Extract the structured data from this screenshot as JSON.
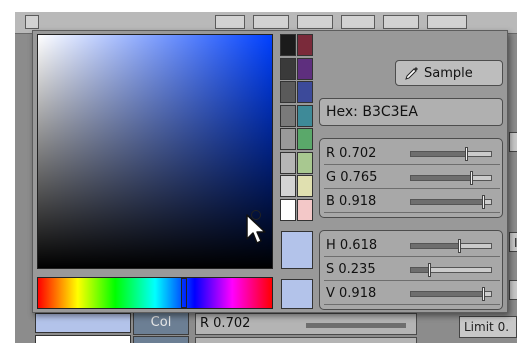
{
  "popup": {
    "sample_button": "Sample",
    "hex_label": "Hex: B3C3EA",
    "rgb": [
      {
        "label": "R 0.702",
        "value": 0.702
      },
      {
        "label": "G 0.765",
        "value": 0.765
      },
      {
        "label": "B 0.918",
        "value": 0.918
      }
    ],
    "hsv": [
      {
        "label": "H 0.618",
        "value": 0.618
      },
      {
        "label": "S 0.235",
        "value": 0.235
      },
      {
        "label": "V 0.918",
        "value": 0.918
      }
    ],
    "current_color": "#b3c3ea",
    "palette": [
      [
        "#1b1b1b",
        "#7a2a3a"
      ],
      [
        "#3a3a3a",
        "#5e2f7e"
      ],
      [
        "#5a5a5a",
        "#3c4a9a"
      ],
      [
        "#7a7a7a",
        "#3e8a98"
      ],
      [
        "#9a9a9a",
        "#5aa86a"
      ],
      [
        "#b6b6b6",
        "#a8c890"
      ],
      [
        "#d4d4d4",
        "#e0e0b0"
      ],
      [
        "#ffffff",
        "#f3c8c8"
      ]
    ],
    "pointer_icon": "mouse-pointer-icon",
    "eyedropper_icon": "eyedropper-icon"
  },
  "background": {
    "col_tab": "Col",
    "r_field": "R 0.702",
    "limit_label": "Limit 0.",
    "sliver_text": "I"
  }
}
